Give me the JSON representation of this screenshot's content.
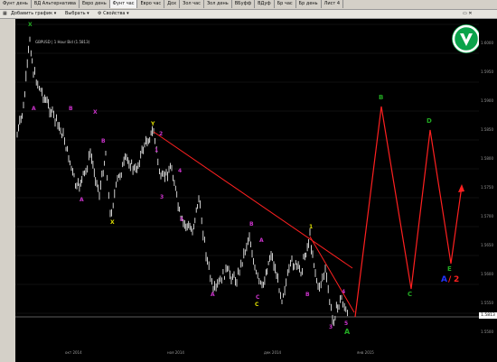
{
  "tabs": [
    "Фунт день",
    "ВД Альтернатива",
    "Евро день",
    "Фунт час",
    "Евро час",
    "Дох",
    "Зол час",
    "Зол день",
    "ВБуфф",
    "ВДуф",
    "Бр час",
    "Бр день",
    "Лист 4"
  ],
  "active_tab_index": 3,
  "toolbar": {
    "add_chart": "Добавить график",
    "select": "Выбрать",
    "properties": "Свойства"
  },
  "chart": {
    "symbol_label": "GBPUSD | 1 Hour Bid (1.5813)",
    "current_price": "1.5813",
    "y_ticks": [
      "1.6000",
      "1.5950",
      "1.5900",
      "1.5850",
      "1.5800",
      "1.5750",
      "1.5700",
      "1.5650",
      "1.5600",
      "1.5550",
      "1.5500"
    ],
    "x_ticks": [
      "окт 2014",
      "ноя 2014",
      "дек 2014",
      "янв 2015"
    ],
    "wave_labels": {
      "X1": "X",
      "A1": "A",
      "B1": "B",
      "X2": "X",
      "B2": "B",
      "A2": "A",
      "X3": "X",
      "Y1": "Y",
      "w1": "1",
      "w2": "2",
      "w3": "3",
      "w4": "4",
      "w5": "5",
      "A3": "A",
      "B3": "B",
      "C1": "C",
      "A4": "A",
      "B4": "B",
      "C2": "C",
      "w1b": "1",
      "w3b": "3",
      "w4b": "4",
      "w5b": "5",
      "A5": "A"
    },
    "projection_labels": {
      "B": "B",
      "C": "C",
      "D": "D",
      "E": "E"
    },
    "scenario": {
      "prefix": "A",
      "slash": "/",
      "number": "2"
    },
    "colors": {
      "up_bar": "#ffffff",
      "projection": "#ff2020",
      "trend": "#ff2020",
      "green_label": "#22aa22",
      "purple_label": "#cc33cc",
      "yellow_label": "#dddd00"
    }
  }
}
